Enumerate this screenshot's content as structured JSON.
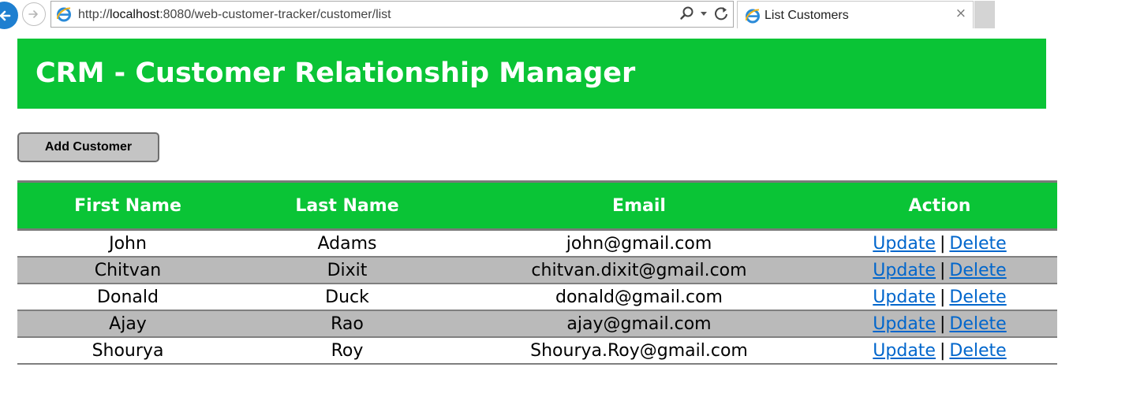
{
  "browser": {
    "url_prefix": "http://",
    "url_host": "localhost",
    "url_rest": ":8080/web-customer-tracker/customer/list",
    "tab_title": "List Customers",
    "tab_close": "×",
    "icons": [
      "back-arrow-icon",
      "forward-arrow-icon",
      "ie-icon",
      "search-icon",
      "dropdown-icon",
      "refresh-icon",
      "close-icon"
    ]
  },
  "header": {
    "title": "CRM - Customer Relationship Manager"
  },
  "toolbar": {
    "add_label": "Add Customer"
  },
  "table": {
    "columns": [
      "First Name",
      "Last Name",
      "Email",
      "Action"
    ],
    "rows": [
      {
        "first": "John",
        "last": "Adams",
        "email": "john@gmail.com"
      },
      {
        "first": "Chitvan",
        "last": "Dixit",
        "email": "chitvan.dixit@gmail.com"
      },
      {
        "first": "Donald",
        "last": "Duck",
        "email": "donald@gmail.com"
      },
      {
        "first": "Ajay",
        "last": "Rao",
        "email": "ajay@gmail.com"
      },
      {
        "first": "Shourya",
        "last": "Roy",
        "email": "Shourya.Roy@gmail.com"
      }
    ],
    "update_label": "Update",
    "delete_label": "Delete",
    "separator": "|"
  },
  "colors": {
    "brand_green": "#0ac436",
    "row_alt": "#bababa",
    "link": "#0066cc"
  }
}
